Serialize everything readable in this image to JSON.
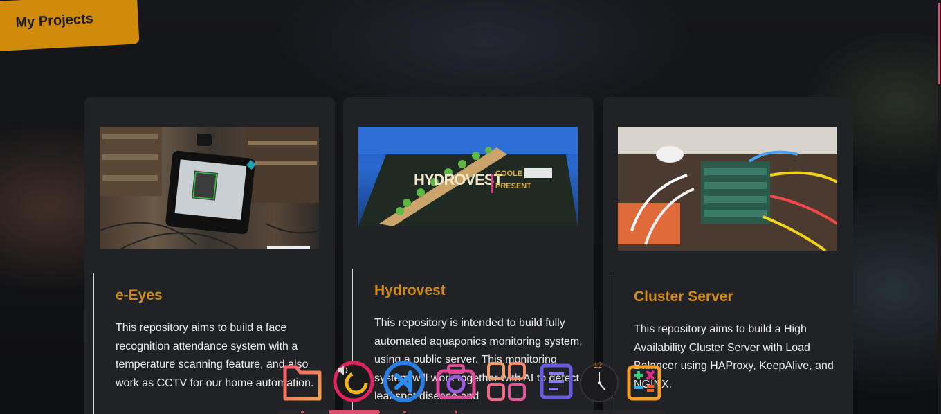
{
  "section": {
    "title": "My Projects"
  },
  "projects": [
    {
      "title": "e-Eyes",
      "description": "This repository aims to build a face recognition attendance system with a temperature scanning feature, and also work as CCTV for our home automation.",
      "image_icon": "face-recognition-tablet-photo"
    },
    {
      "title": "Hydrovest",
      "description": "This repository is intended to build fully automated aquaponics monitoring system, using a public server. This monitoring system will work together with AI to detect leaf spot disease and",
      "image_icon": "aquaponics-pond-photo",
      "image_caption": {
        "main": "HYDROVEST",
        "side_1": "COOLE",
        "side_2": "PRESENT"
      }
    },
    {
      "title": "Cluster Server",
      "description": "This repository aims to build a High Availability Cluster Server with Load Balancer using HAProxy, KeepAlive, and NGINX.",
      "image_icon": "raspberry-pi-cluster-photo"
    }
  ],
  "dock": {
    "icons": [
      "folder-icon",
      "volume-icon",
      "code-editor-icon",
      "camera-icon",
      "app-grid-icon",
      "notes-icon",
      "clock-icon",
      "calculator-icon"
    ],
    "clock_label": "12"
  },
  "colors": {
    "accent": "#d18b0a",
    "title": "#d18b16",
    "card": "#212225",
    "highlight": "#d9506f"
  }
}
